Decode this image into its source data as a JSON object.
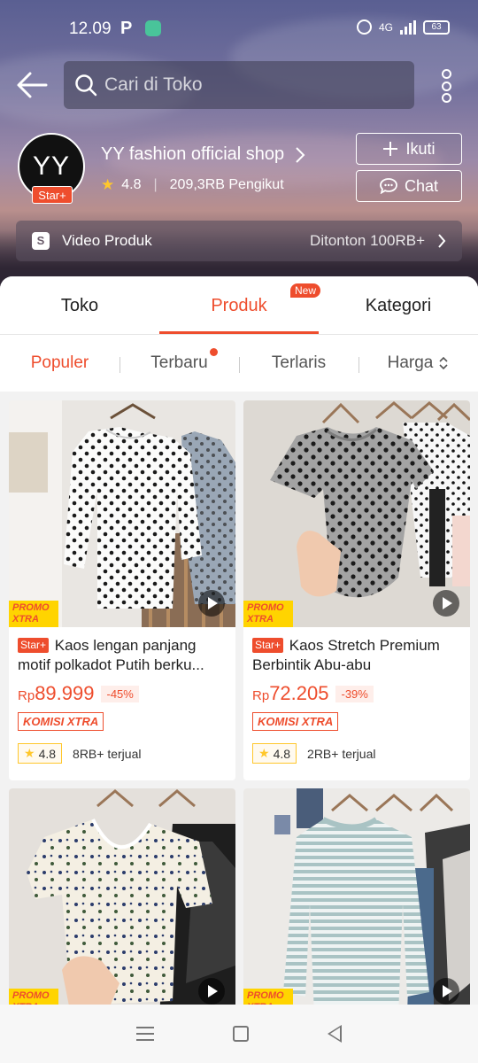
{
  "status": {
    "time": "12.09",
    "p_label": "P",
    "network": "4G",
    "battery": "63"
  },
  "search": {
    "placeholder": "Cari di Toko"
  },
  "shop": {
    "avatar_text": "YY",
    "badge": "Star+",
    "name": "YY fashion official shop",
    "rating": "4.8",
    "followers": "209,3RB Pengikut",
    "follow_label": "Ikuti",
    "chat_label": "Chat"
  },
  "video_bar": {
    "label": "Video Produk",
    "views": "Ditonton 100RB+"
  },
  "tabs": [
    {
      "label": "Toko"
    },
    {
      "label": "Produk",
      "badge": "New"
    },
    {
      "label": "Kategori"
    }
  ],
  "sorts": [
    {
      "label": "Populer"
    },
    {
      "label": "Terbaru"
    },
    {
      "label": "Terlaris"
    },
    {
      "label": "Harga"
    }
  ],
  "products": [
    {
      "badge": "Star+",
      "title": "Kaos lengan panjang motif polkadot  Putih berku...",
      "currency": "Rp",
      "price": "89.999",
      "discount": "-45%",
      "komisi": "KOMISI XTRA",
      "rating": "4.8",
      "sold": "8RB+ terjual",
      "promo": "PROMO XTRA"
    },
    {
      "badge": "Star+",
      "title": "Kaos Stretch Premium Berbintik Abu-abu",
      "currency": "Rp",
      "price": "72.205",
      "discount": "-39%",
      "komisi": "KOMISI XTRA",
      "rating": "4.8",
      "sold": "2RB+ terjual",
      "promo": "PROMO XTRA"
    },
    {
      "promo": "PROMO XTRA"
    },
    {
      "promo": "PROMO XTRA"
    }
  ],
  "colors": {
    "accent": "#ee4d2d",
    "star": "#ffc72c",
    "promo_bg": "#ffd400"
  }
}
